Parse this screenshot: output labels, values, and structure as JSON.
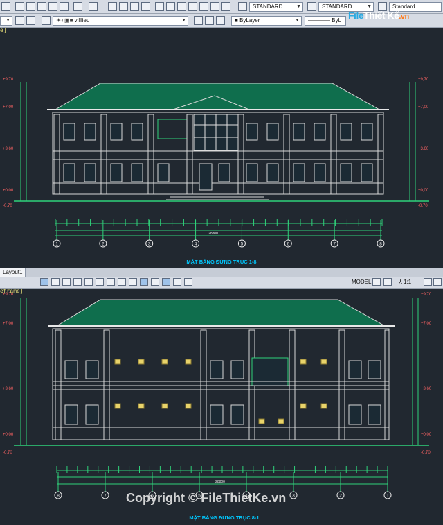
{
  "toolbar1": {
    "text_style": "STANDARD",
    "dim_style": "STANDARD",
    "table_style": "Standard"
  },
  "toolbar2": {
    "layer": "vllllieu",
    "color": "ByLayer",
    "linetype": "ByL"
  },
  "viewport1": {
    "label": "e]",
    "title": "MẶT BẰNG ĐỨNG TRỤC 1-8",
    "axes": [
      "1",
      "2",
      "3",
      "4",
      "5",
      "6",
      "7",
      "8"
    ],
    "total_dim": "28800",
    "levels": [
      "+9,70",
      "+7,00",
      "+3,60",
      "+0,00",
      "-0,70"
    ]
  },
  "layout_bar": {
    "tab": "Layout1",
    "model": "MODEL",
    "scale": "1:1"
  },
  "viewport2": {
    "label": "eframe]",
    "title": "MẶT BẰNG ĐỨNG TRỤC 8-1",
    "axes": [
      "8",
      "7",
      "6",
      "5",
      "4",
      "3",
      "2",
      "1"
    ],
    "total_dim": "28800",
    "levels": [
      "+9,70",
      "+7,00",
      "+3,60",
      "+0,00",
      "-0,70"
    ]
  },
  "logo": {
    "part1": "File",
    "part2": "Thiết Kế",
    "part3": ".vn"
  },
  "watermark": "Copyright © FileThietKe.vn",
  "colors": {
    "background": "#212830",
    "roof": "#0f7a55",
    "linework": "#e8e8e8",
    "dimension": "#2fd27a",
    "title": "#00c8ff",
    "level_marks": "#ff6464"
  }
}
